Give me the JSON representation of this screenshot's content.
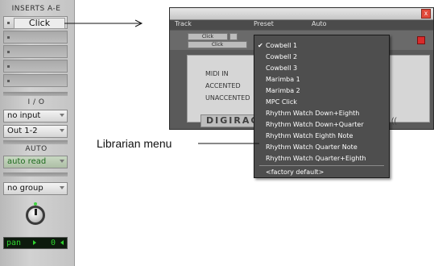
{
  "channel_strip": {
    "inserts_label": "INSERTS A-E",
    "insert_a": "Click",
    "io_label": "I / O",
    "input": "no input",
    "output": "Out 1-2",
    "auto_label": "AUTO",
    "auto_mode": "auto read",
    "group": "no group",
    "pan_label": "pan",
    "pan_value": "0"
  },
  "plugin_window": {
    "headers": [
      "Track",
      "Preset",
      "Auto"
    ],
    "track_name": "Click",
    "plugin_name": "Click",
    "params": [
      "MIDI IN",
      "ACCENTED",
      "UNACCENTED"
    ],
    "brand": "DIGIRACK",
    "close": "x",
    "right_glyph": "(("
  },
  "librarian_menu": {
    "selected": "Cowbell 1",
    "items": [
      "Cowbell 1",
      "Cowbell 2",
      "Cowbell 3",
      "Marimba 1",
      "Marimba 2",
      "MPC Click",
      "Rhythm Watch Down+Eighth",
      "Rhythm Watch Down+Quarter",
      "Rhythm Watch Eighth Note",
      "Rhythm Watch Quarter Note",
      "Rhythm Watch Quarter+Eighth"
    ],
    "factory": "<factory default>"
  },
  "callouts": {
    "librarian": "Librarian menu"
  },
  "colors": {
    "pan_green": "#2fd22f",
    "auto_green": "#1c6a1c",
    "menu_bg": "#4e4e4e"
  }
}
